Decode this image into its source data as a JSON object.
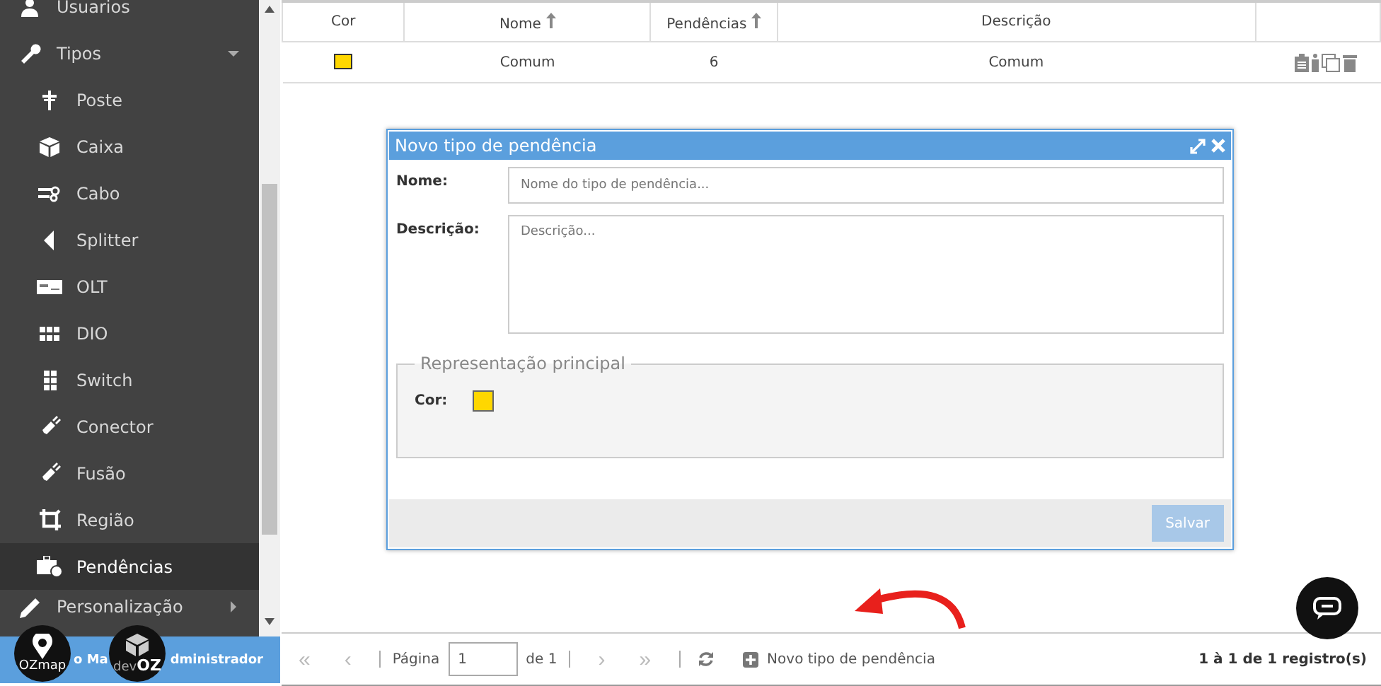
{
  "sidebar": {
    "items": [
      {
        "label": "Usuarios",
        "kind": "user",
        "selected": false
      },
      {
        "label": "Tipos",
        "kind": "wrench",
        "selected": false,
        "expanded": true,
        "children": [
          {
            "label": "Poste",
            "kind": "pole",
            "selected": false
          },
          {
            "label": "Caixa",
            "kind": "cube",
            "selected": false
          },
          {
            "label": "Cabo",
            "kind": "cable",
            "selected": false
          },
          {
            "label": "Splitter",
            "kind": "triangle",
            "selected": false
          },
          {
            "label": "OLT",
            "kind": "card",
            "selected": false
          },
          {
            "label": "DIO",
            "kind": "grid",
            "selected": false
          },
          {
            "label": "Switch",
            "kind": "columns",
            "selected": false
          },
          {
            "label": "Conector",
            "kind": "plug",
            "selected": false
          },
          {
            "label": "Fusão",
            "kind": "plug",
            "selected": false
          },
          {
            "label": "Região",
            "kind": "crop",
            "selected": false
          },
          {
            "label": "Pendências",
            "kind": "briefcase",
            "selected": true
          }
        ]
      },
      {
        "label": "Personalização",
        "kind": "pencil",
        "selected": false,
        "expanded": false
      }
    ],
    "footer": {
      "user_parts": [
        "o Ma",
        "dministrador"
      ]
    },
    "logos": [
      {
        "text": "OZmap",
        "kind": "pin"
      },
      {
        "text_light": "dev",
        "text_bold": "OZ",
        "kind": "box"
      }
    ]
  },
  "table": {
    "columns": [
      {
        "label": "Cor",
        "sorted": false
      },
      {
        "label": "Nome",
        "sorted": true
      },
      {
        "label": "Pendências",
        "sorted": true
      },
      {
        "label": "Descrição",
        "sorted": false
      },
      {
        "sorted": false
      }
    ],
    "rows": [
      {
        "color": "#ffd700",
        "name": "Comum",
        "count": "6",
        "description": "Comum"
      }
    ]
  },
  "dialog": {
    "title": "Novo tipo de pendência",
    "name_label": "Nome:",
    "name_placeholder": "Nome do tipo de pendência...",
    "desc_label": "Descrição:",
    "desc_placeholder": "Descrição...",
    "fieldset_legend": "Representação principal",
    "color_label": "Cor:",
    "color": "#ffd700",
    "save": "Salvar",
    "save_disabled": true
  },
  "pager": {
    "first": "«",
    "prev": "‹",
    "page_label": "Página",
    "page": "1",
    "of": "de 1",
    "next": "›",
    "last": "»",
    "new_label": "Novo tipo de pendência",
    "summary": "1 à 1 de 1 registro(s)"
  }
}
